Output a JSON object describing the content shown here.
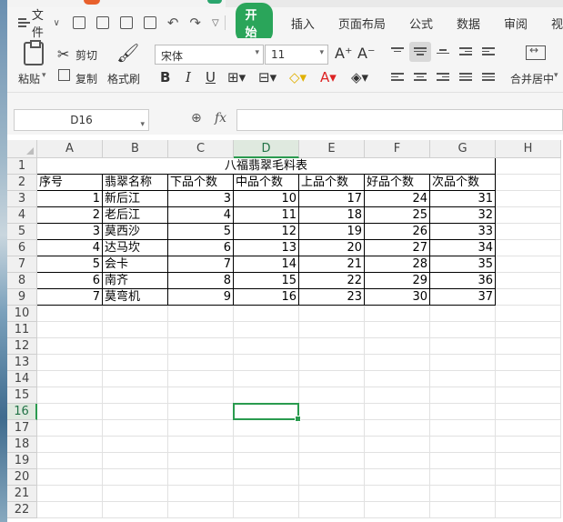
{
  "menu": {
    "file_label": "文件",
    "tabs": [
      "开始",
      "插入",
      "页面布局",
      "公式",
      "数据",
      "审阅",
      "视"
    ]
  },
  "ribbon": {
    "cut": "剪切",
    "copy": "复制",
    "paste": "粘贴",
    "format_painter": "格式刷",
    "font_name": "宋体",
    "font_size": "11",
    "bold": "B",
    "italic": "I",
    "underline": "U",
    "merge_center": "合并居中"
  },
  "formula_bar": {
    "name_box": "D16",
    "fx_label": "fx",
    "value": ""
  },
  "sheet": {
    "columns": [
      "A",
      "B",
      "C",
      "D",
      "E",
      "F",
      "G",
      "H"
    ],
    "rows": [
      "1",
      "2",
      "3",
      "4",
      "5",
      "6",
      "7",
      "8",
      "9",
      "10",
      "11",
      "12",
      "13",
      "14",
      "15",
      "16",
      "17",
      "18",
      "19",
      "20",
      "21",
      "22"
    ],
    "active_cell": "D16",
    "title": "八福翡翠毛料表",
    "headers": [
      "序号",
      "翡翠名称",
      "下品个数",
      "中品个数",
      "上品个数",
      "好品个数",
      "次品个数"
    ],
    "data": [
      [
        "1",
        "新后江",
        "3",
        "10",
        "17",
        "24",
        "31"
      ],
      [
        "2",
        "老后江",
        "4",
        "11",
        "18",
        "25",
        "32"
      ],
      [
        "3",
        "莫西沙",
        "5",
        "12",
        "19",
        "26",
        "33"
      ],
      [
        "4",
        "达马坎",
        "6",
        "13",
        "20",
        "27",
        "34"
      ],
      [
        "5",
        "会卡",
        "7",
        "14",
        "21",
        "28",
        "35"
      ],
      [
        "6",
        "南齐",
        "8",
        "15",
        "22",
        "29",
        "36"
      ],
      [
        "7",
        "莫弯机",
        "9",
        "16",
        "23",
        "30",
        "37"
      ]
    ]
  }
}
